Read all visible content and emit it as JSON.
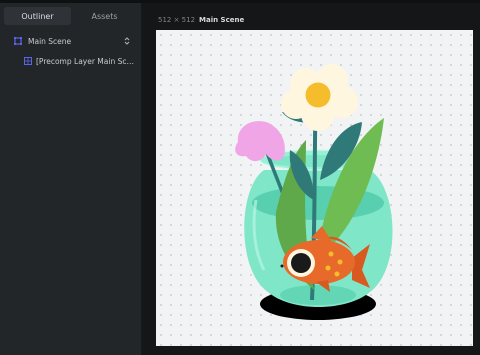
{
  "panel": {
    "tabs": [
      {
        "label": "Outliner",
        "active": true
      },
      {
        "label": "Assets",
        "active": false
      }
    ],
    "tree": [
      {
        "label": "Main Scene",
        "icon": "composition-icon",
        "expanded": true
      },
      {
        "label": "[Precomp Layer Main Scen…",
        "icon": "precomp-layer-icon"
      }
    ]
  },
  "canvas": {
    "size_label": "512 × 512",
    "scene_label": "Main Scene"
  },
  "colors": {
    "accent": "#5b63e8",
    "bowl_water": "#7fe6c8",
    "fish": "#e86a2a",
    "flower_white": "#fff6e0",
    "flower_center": "#f5bd2c",
    "flower_pink": "#f0a6e6",
    "leaf_dark": "#2f7a78",
    "leaf_green": "#5fa94a"
  }
}
